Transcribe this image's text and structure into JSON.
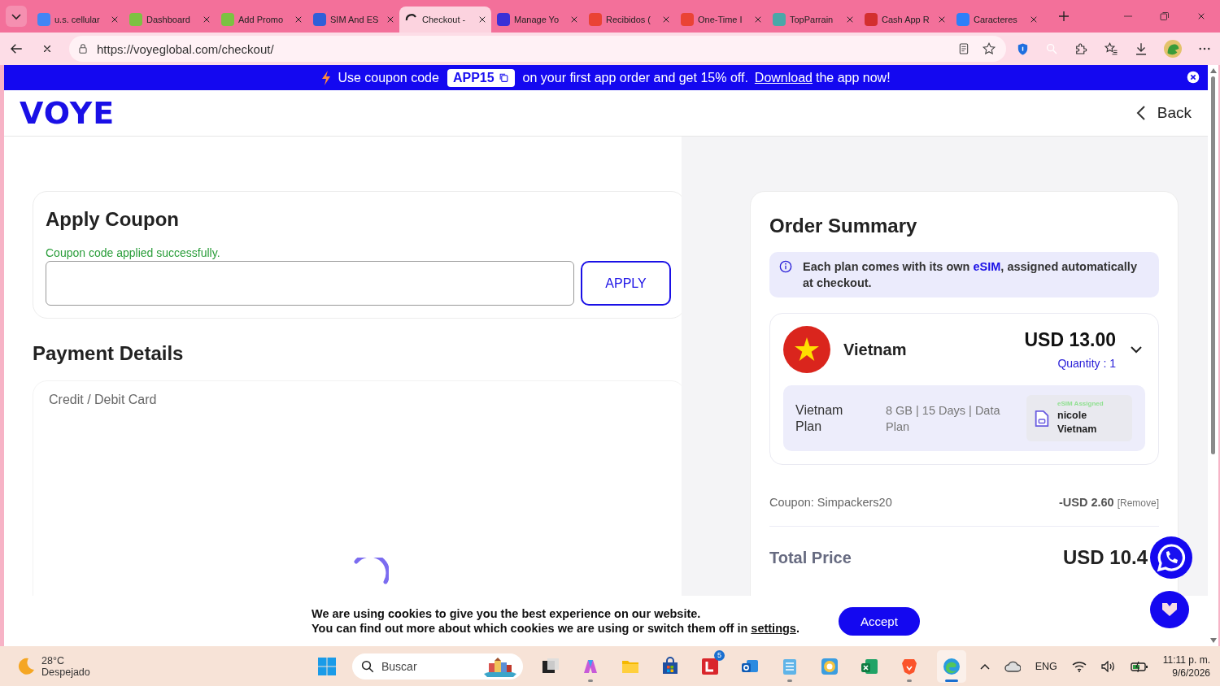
{
  "browser": {
    "tabs": [
      {
        "title": "u.s. cellular",
        "selected": false,
        "loading": false,
        "color": "#4285f4"
      },
      {
        "title": "Dashboard",
        "selected": false,
        "loading": false,
        "color": "#7cc242"
      },
      {
        "title": "Add Promo",
        "selected": false,
        "loading": false,
        "color": "#7cc242"
      },
      {
        "title": "SIM And ES",
        "selected": false,
        "loading": false,
        "color": "#2f5fd8"
      },
      {
        "title": "Checkout -",
        "selected": true,
        "loading": true
      },
      {
        "title": "Manage Yo",
        "selected": false,
        "loading": false,
        "color": "#3b30d6"
      },
      {
        "title": "Recibidos (",
        "selected": false,
        "loading": false,
        "color": "#ea4335"
      },
      {
        "title": "One-Time I",
        "selected": false,
        "loading": false,
        "color": "#ea4335"
      },
      {
        "title": "TopParrain",
        "selected": false,
        "loading": false,
        "color": "#4aa7a8"
      },
      {
        "title": "Cash App R",
        "selected": false,
        "loading": false,
        "color": "#d32f2f"
      },
      {
        "title": "Caracteres",
        "selected": false,
        "loading": false,
        "color": "#2d7ff9"
      }
    ],
    "url": "https://voyeglobal.com/checkout/"
  },
  "promo_banner": {
    "text_before": "Use coupon code",
    "code": "APP15",
    "text_middle": "on your first app order and get 15% off.",
    "link": "Download",
    "text_after": "the app now!"
  },
  "header": {
    "logo": "VOYE",
    "back": "Back"
  },
  "coupon": {
    "title": "Apply Coupon",
    "message": "Coupon code applied successfully.",
    "button": "APPLY"
  },
  "payment": {
    "title": "Payment Details",
    "method": "Credit / Debit Card"
  },
  "order_summary": {
    "title": "Order Summary",
    "note": {
      "text_before": "Each plan comes with its own ",
      "link": "eSIM",
      "text_after": ", assigned automatically at checkout."
    },
    "item": {
      "country": "Vietnam",
      "price": "USD 13.00",
      "quantity": "Quantity : 1",
      "plan": "Vietnam Plan",
      "details": "8 GB | 15 Days | Data Plan",
      "esim_label": "eSIM Assigned",
      "esim_name": "nicole Vietnam"
    },
    "coupon": {
      "label": "Coupon: Simpackers20",
      "amount": "-USD 2.60",
      "remove": "[Remove]"
    },
    "total": {
      "label": "Total Price",
      "amount": "USD 10.4"
    }
  },
  "cookie_bar": {
    "line1": "We are using cookies to give you the best experience on our website.",
    "line2_before": "You can find out more about which cookies we are using or switch them off in ",
    "link": "settings",
    "line2_after": ".",
    "button": "Accept"
  },
  "taskbar": {
    "weather": {
      "temp": "28°C",
      "condition": "Despejado"
    },
    "search_placeholder": "Buscar",
    "apps": [
      {
        "kind": "taskview",
        "running": false,
        "selected": false
      },
      {
        "kind": "copilot",
        "running": true,
        "selected": false
      },
      {
        "kind": "folder",
        "running": false,
        "selected": false
      },
      {
        "kind": "store",
        "running": false,
        "selected": false
      },
      {
        "kind": "lapp",
        "running": false,
        "selected": false,
        "badge": "5"
      },
      {
        "kind": "outlook",
        "running": false,
        "selected": false
      },
      {
        "kind": "notepad",
        "running": true,
        "selected": false
      },
      {
        "kind": "colorwheel",
        "running": false,
        "selected": false
      },
      {
        "kind": "excel",
        "running": false,
        "selected": false
      },
      {
        "kind": "brave",
        "running": true,
        "selected": false
      },
      {
        "kind": "edge",
        "running": true,
        "selected": true
      }
    ],
    "language": "ENG",
    "time": "11:11 p. m.",
    "date": "9/6/2026"
  }
}
